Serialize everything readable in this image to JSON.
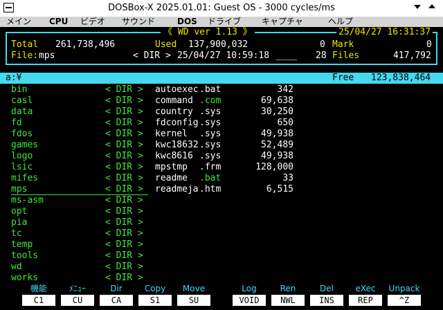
{
  "window": {
    "title": "DOSBox-X 2025.01.01: Guest OS - 3000 cycles/ms"
  },
  "menu": [
    "メイン",
    "CPU",
    "ビデオ",
    "サウンド",
    "DOS",
    "ドライブ",
    "キャプチャ",
    "ヘルプ"
  ],
  "header": {
    "legend_left": "《",
    "app_name": "WD ver 1.13",
    "legend_right": "》",
    "datetime": "25/04/27 16:31:37"
  },
  "info": {
    "total_label": "Total",
    "total_value": "261,738,496",
    "used_label": "Used",
    "used_value": "137,900,032",
    "mark_count": "0",
    "mark_label": "Mark",
    "mark_value": "0",
    "file_label": "File:",
    "file_name": "mps",
    "file_dir": "< DIR >",
    "file_date": "25/04/27 10:59:18",
    "file_attr": "____",
    "files_count": "28",
    "files_label": "Files",
    "files_value": "417,792"
  },
  "pathbar": {
    "path": "a:¥",
    "free_label": "Free",
    "free_value": "123,838,464"
  },
  "dirs": [
    {
      "name": "bin",
      "tag": "< DIR >"
    },
    {
      "name": "casl",
      "tag": "< DIR >"
    },
    {
      "name": "data",
      "tag": "< DIR >"
    },
    {
      "name": "fd",
      "tag": "< DIR >"
    },
    {
      "name": "fdos",
      "tag": "< DIR >"
    },
    {
      "name": "games",
      "tag": "< DIR >"
    },
    {
      "name": "logo",
      "tag": "< DIR >"
    },
    {
      "name": "lsic",
      "tag": "< DIR >"
    },
    {
      "name": "mifes",
      "tag": "< DIR >"
    },
    {
      "name": "mps",
      "tag": "< DIR >"
    },
    {
      "name": "ms-asm",
      "tag": "< DIR >"
    },
    {
      "name": "opt",
      "tag": "< DIR >"
    },
    {
      "name": "pia",
      "tag": "< DIR >"
    },
    {
      "name": "tc",
      "tag": "< DIR >"
    },
    {
      "name": "temp",
      "tag": "< DIR >"
    },
    {
      "name": "tools",
      "tag": "< DIR >"
    },
    {
      "name": "wd",
      "tag": "< DIR >"
    },
    {
      "name": "works",
      "tag": "< DIR >"
    }
  ],
  "files": [
    {
      "base": "autoexec",
      "ext": ".bat",
      "size": "342"
    },
    {
      "base": "command",
      "ext": ".com",
      "size": "69,638"
    },
    {
      "base": "country",
      "ext": ".sys",
      "size": "30,250"
    },
    {
      "base": "fdconfig",
      "ext": ".sys",
      "size": "650"
    },
    {
      "base": "kernel",
      "ext": ".sys",
      "size": "49,938"
    },
    {
      "base": "kwc18632",
      "ext": ".sys",
      "size": "52,489"
    },
    {
      "base": "kwc8616",
      "ext": ".sys",
      "size": "49,938"
    },
    {
      "base": "mpstmp",
      "ext": ".frm",
      "size": "128,000"
    },
    {
      "base": "readme",
      "ext": ".bat",
      "size": "33"
    },
    {
      "base": "readmeja",
      "ext": ".htm",
      "size": "6,515"
    }
  ],
  "fkeys": [
    {
      "label": "機能",
      "key": "C1"
    },
    {
      "label": "ﾒﾆｭｰ",
      "key": "CU"
    },
    {
      "label": "Dir",
      "key": "CA"
    },
    {
      "label": "Copy",
      "key": "S1"
    },
    {
      "label": "Move",
      "key": "SU"
    },
    {
      "label": "Log",
      "key": "VOID"
    },
    {
      "label": "Ren",
      "key": "NWL"
    },
    {
      "label": "Del",
      "key": "INS"
    },
    {
      "label": "eXec",
      "key": "REP"
    },
    {
      "label": "Unpack",
      "key": "^Z"
    }
  ],
  "colors": {
    "cyan": "#45d8ee",
    "green": "#3ee83e",
    "yellow": "#e8e800",
    "white": "#ffffff"
  }
}
